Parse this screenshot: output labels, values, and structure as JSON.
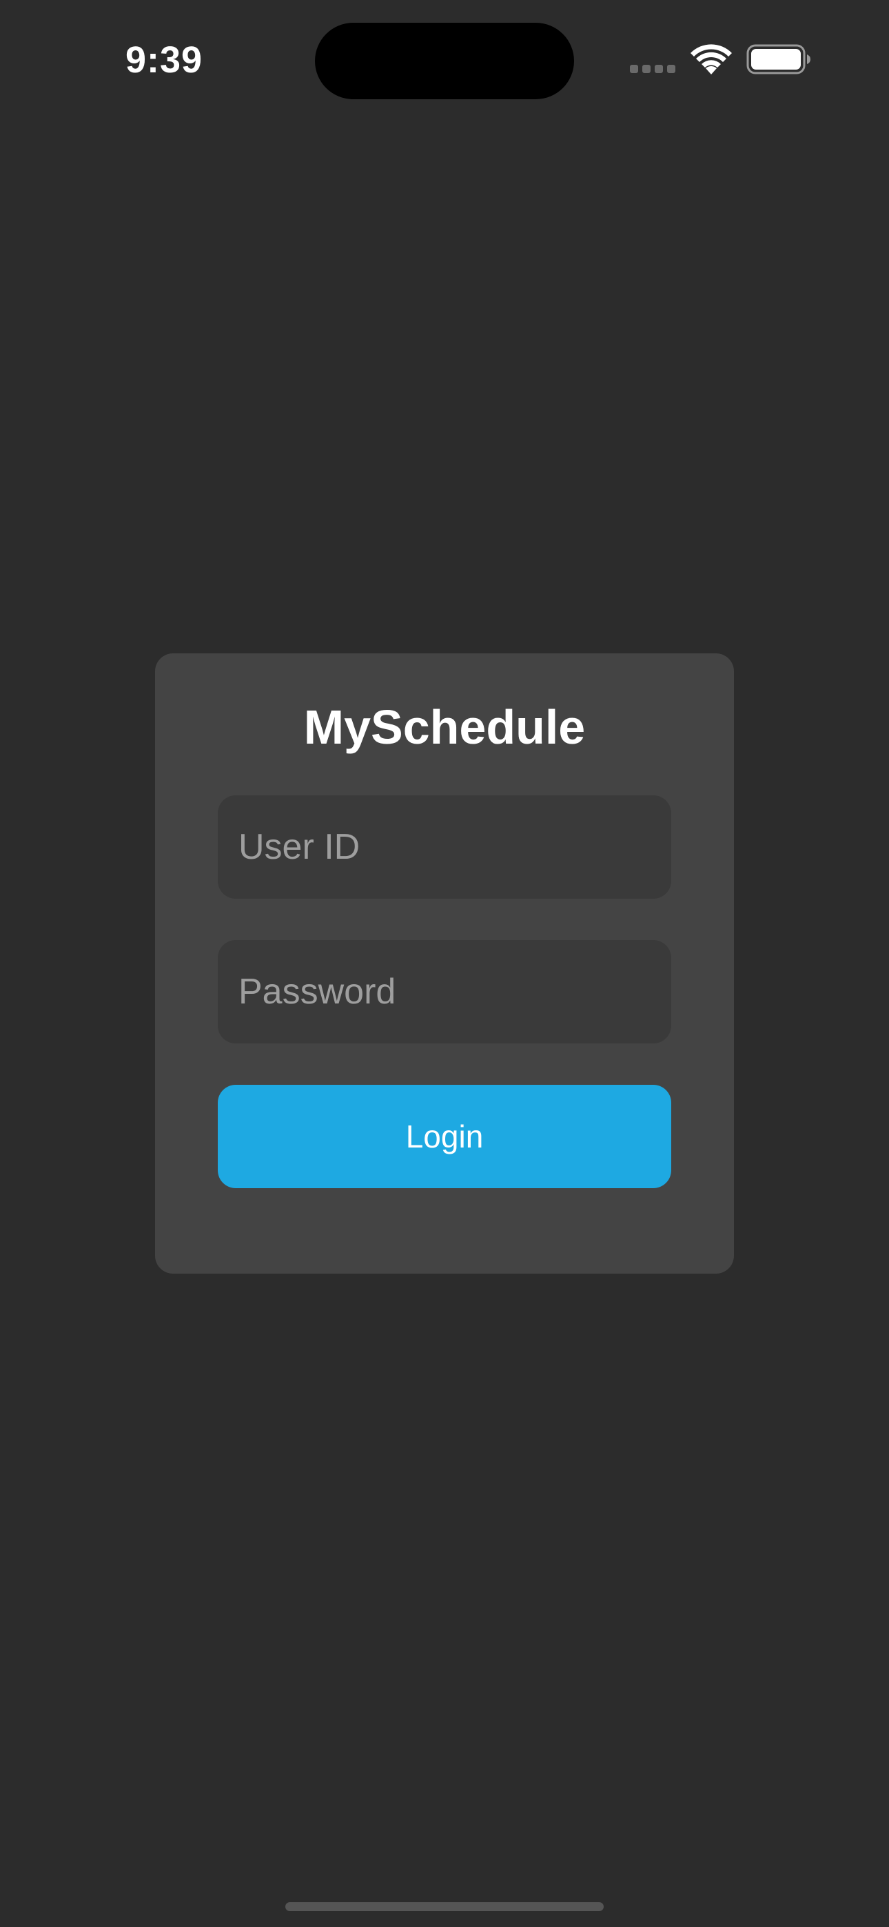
{
  "status_bar": {
    "time": "9:39",
    "signal_icon": "cellular-signal-icon",
    "wifi_icon": "wifi-icon",
    "battery_icon": "battery-icon"
  },
  "login_card": {
    "title": "MySchedule",
    "user_id": {
      "placeholder": "User ID",
      "value": ""
    },
    "password": {
      "placeholder": "Password",
      "value": ""
    },
    "login_label": "Login"
  },
  "colors": {
    "background": "#2c2c2c",
    "card": "#444444",
    "field": "#3a3a3a",
    "accent": "#1ea9e2",
    "placeholder": "#9e9e9e"
  }
}
